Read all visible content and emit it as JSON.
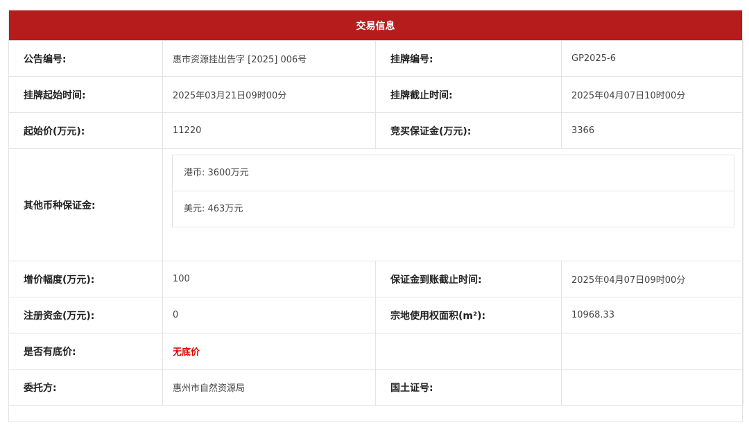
{
  "header": {
    "title": "交易信息"
  },
  "rows": {
    "r1": {
      "l1": "公告编号:",
      "v1": "惠市资源挂出告字 [2025] 006号",
      "l2": "挂牌编号:",
      "v2": "GP2025-6"
    },
    "r2": {
      "l1": "挂牌起始时间:",
      "v1": "2025年03月21日09时00分",
      "l2": "挂牌截止时间:",
      "v2": "2025年04月07日10时00分"
    },
    "r3": {
      "l1": "起始价(万元):",
      "v1": "11220",
      "l2": "竞买保证金(万元):",
      "v2": "3366"
    },
    "r4": {
      "l1": "其他币种保证金:",
      "items": [
        "港币: 3600万元",
        "美元: 463万元"
      ]
    },
    "r5": {
      "l1": "增价幅度(万元):",
      "v1": "100",
      "l2": "保证金到账截止时间:",
      "v2": "2025年04月07日09时00分"
    },
    "r6": {
      "l1": "注册资金(万元):",
      "v1": "0",
      "l2": "宗地使用权面积(m²):",
      "v2": "10968.33"
    },
    "r7": {
      "l1": "是否有底价:",
      "v1": "无底价",
      "l2": "",
      "v2": ""
    },
    "r8": {
      "l1": "委托方:",
      "v1": "惠州市自然资源局",
      "l2": "国土证号:",
      "v2": ""
    }
  },
  "colors": {
    "header_bg": "#b71c1c",
    "no_reserve_text": "#e00000"
  }
}
